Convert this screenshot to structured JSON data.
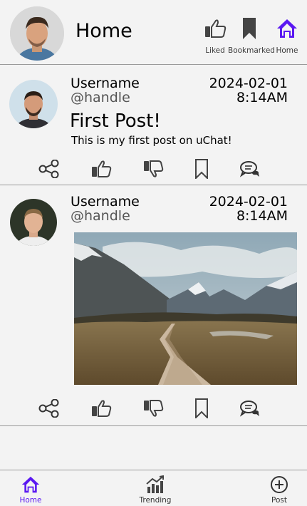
{
  "header": {
    "title": "Home",
    "nav": [
      {
        "label": "Liked",
        "icon": "thumbs-up-icon"
      },
      {
        "label": "Bookmarked",
        "icon": "bookmark-icon"
      },
      {
        "label": "Home",
        "icon": "home-icon"
      }
    ]
  },
  "posts": [
    {
      "username": "Username",
      "handle": "@handle",
      "date": "2024-02-01",
      "time": "8:14AM",
      "title": "First Post!",
      "body": "This is my first post on uChat!"
    },
    {
      "username": "Username",
      "handle": "@handle",
      "date": "2024-02-01",
      "time": "8:14AM"
    }
  ],
  "actions": [
    "share-icon",
    "like-icon",
    "dislike-icon",
    "bookmark-icon",
    "comment-icon"
  ],
  "bottom_nav": [
    {
      "label": "Home",
      "icon": "home-icon"
    },
    {
      "label": "Trending",
      "icon": "trending-icon"
    },
    {
      "label": "Post",
      "icon": "add-post-icon"
    }
  ],
  "colors": {
    "accent": "#5a18f2",
    "background": "#f3f3f3",
    "divider": "#9a9a9a"
  }
}
